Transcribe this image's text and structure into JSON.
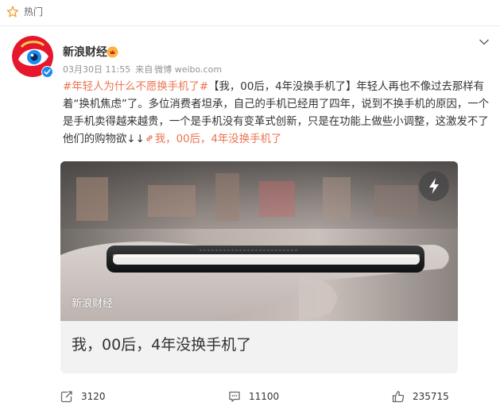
{
  "hot_bar": {
    "label": "热门",
    "icon": "star-outline-icon"
  },
  "post": {
    "author": {
      "name": "新浪财经",
      "avatar_icon": "sina-eye-logo",
      "verified_icon": "blue-verified-v"
    },
    "meta": {
      "date": "03月30日 11:55",
      "source_prefix": "来自",
      "source": "微博 weibo.com"
    },
    "text": {
      "topic": "#年轻人为什么不愿换手机了#",
      "body": "【我，00后，4年没换手机了】年轻人再也不像过去那样有着“换机焦虑”了。多位消费者坦承，自己的手机已经用了四年，说到不换手机的原因，一个是手机卖得越来越贵，一个是手机没有变革式创新，只是在功能上做些小调整，这激发不了他们的购物欲↓↓",
      "link_text": "我，00后，4年没换手机了",
      "link_icon": "link-icon"
    },
    "card": {
      "watermark": "新浪财经",
      "title": "我，00后，4年没换手机了",
      "badge_icon": "lightning-icon"
    },
    "actions": {
      "repost": {
        "icon": "repost-icon",
        "count": "3120"
      },
      "comment": {
        "icon": "comment-icon",
        "count": "11100"
      },
      "like": {
        "icon": "thumbs-up-icon",
        "count": "235715"
      }
    }
  },
  "colors": {
    "accent": "#eb7350",
    "verified": "#1a8cf0",
    "brand_red": "#e6162d"
  }
}
